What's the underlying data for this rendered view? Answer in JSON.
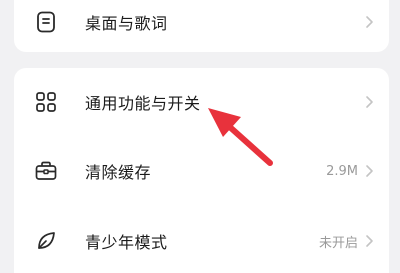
{
  "top_card": {
    "item": {
      "label": "桌面与歌词",
      "icon": "lyrics-document-icon"
    }
  },
  "main_card": {
    "items": [
      {
        "label": "通用功能与开关",
        "value": "",
        "icon": "grid-four-squares-icon"
      },
      {
        "label": "清除缓存",
        "value": "2.9M",
        "icon": "briefcase-icon"
      },
      {
        "label": "青少年模式",
        "value": "未开启",
        "icon": "leaf-icon"
      }
    ]
  },
  "annotation": {
    "arrow_color": "#e8323c"
  }
}
